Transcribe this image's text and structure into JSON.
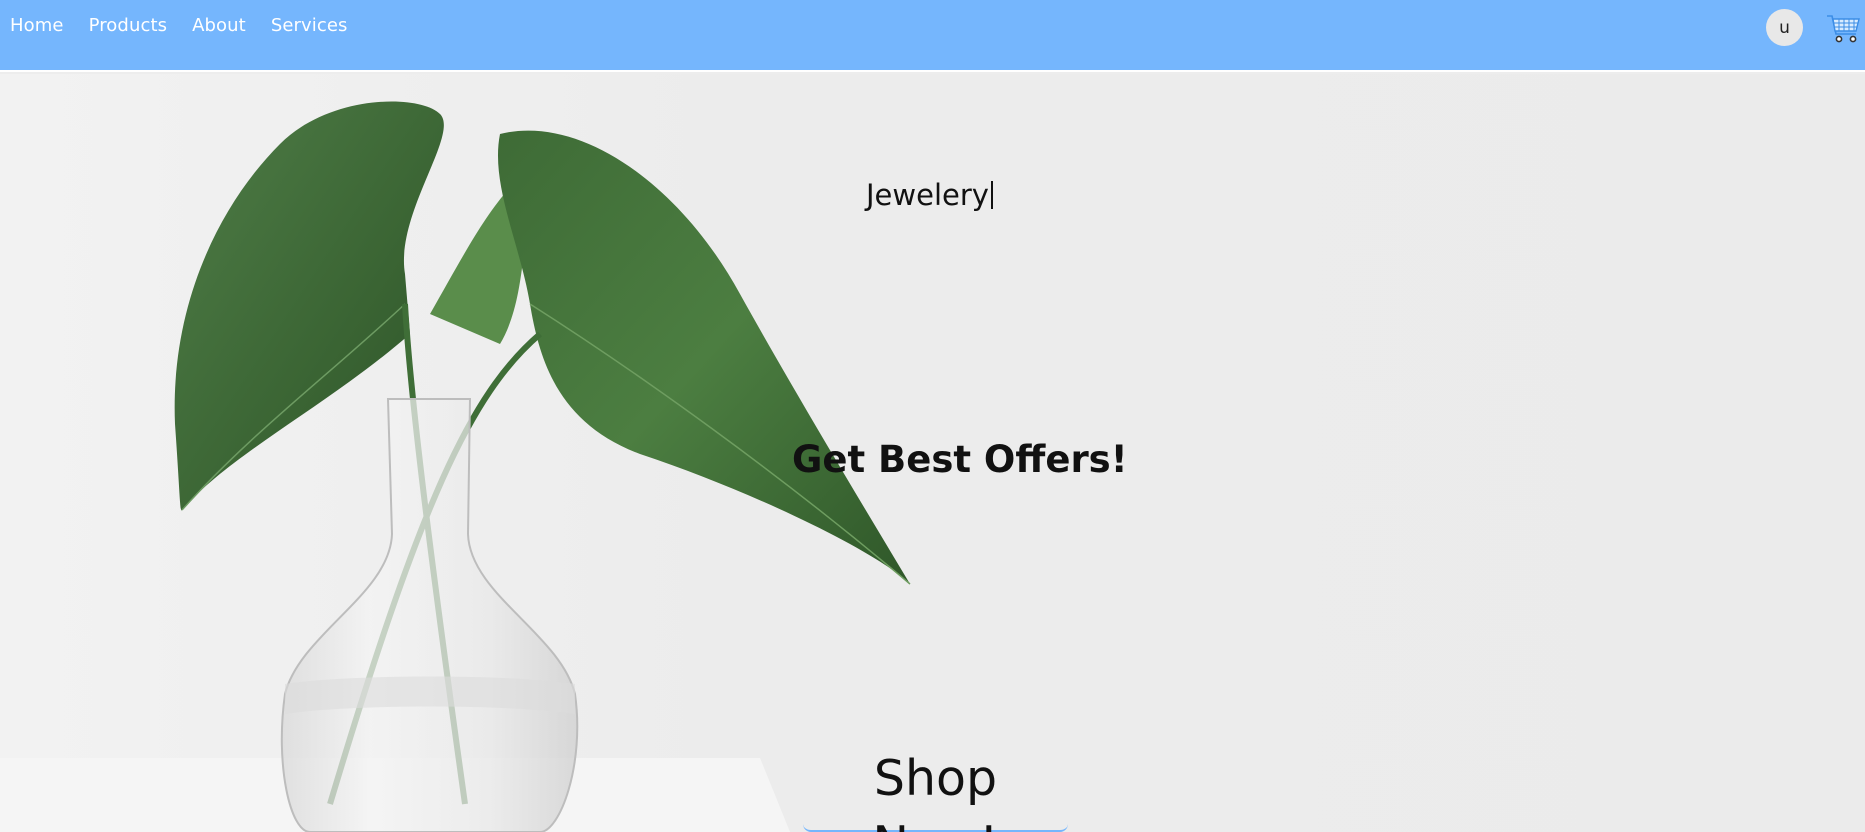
{
  "nav": {
    "links": [
      {
        "label": "Home"
      },
      {
        "label": "Products"
      },
      {
        "label": "About"
      },
      {
        "label": "Services"
      }
    ],
    "avatar_letter": "u",
    "cart_icon": "shopping-cart-icon"
  },
  "hero": {
    "typed_text": "Jewelery",
    "headline": "Get Best Offers!",
    "cta_label": "Shop Now!",
    "image_subject": "leaf-stems-in-glass-vase"
  },
  "colors": {
    "navbar": "#75b6fd",
    "background": "#ededed",
    "text": "#111111"
  }
}
